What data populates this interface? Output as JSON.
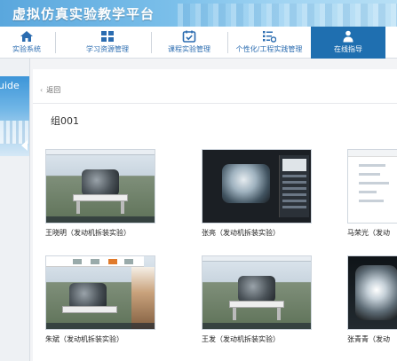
{
  "header": {
    "title": "虚拟仿真实验教学平台"
  },
  "nav": {
    "items": [
      {
        "label": "实验系统",
        "icon": "home-icon"
      },
      {
        "label": "学习资源管理",
        "icon": "resources-icon"
      },
      {
        "label": "课程实验管理",
        "icon": "calendar-check-icon"
      },
      {
        "label": "个性化/工程实践管理",
        "icon": "list-settings-icon"
      },
      {
        "label": "在线指导",
        "icon": "user-guide-icon",
        "active": true
      }
    ]
  },
  "left": {
    "banner_text": "uide"
  },
  "main": {
    "back_label": "返回",
    "group_title": "组001",
    "cards": [
      {
        "caption": "王晓明（发动机拆装实验）"
      },
      {
        "caption": "张亮（发动机拆装实验）"
      },
      {
        "caption": "马荣光（发动"
      },
      {
        "caption": "朱斌（发动机拆装实验）"
      },
      {
        "caption": "王发（发动机拆装实验）"
      },
      {
        "caption": "张青青（发动"
      }
    ]
  },
  "colors": {
    "accent": "#1f6fb0",
    "nav_text": "#2b6cb0",
    "header_start": "#5aa7dd"
  }
}
